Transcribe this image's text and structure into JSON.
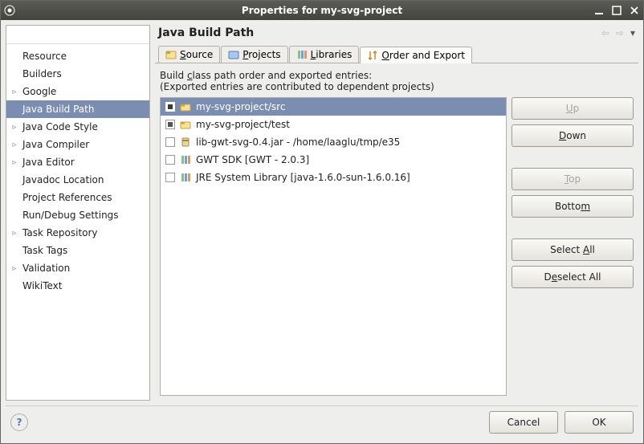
{
  "window": {
    "title": "Properties for my-svg-project"
  },
  "nav": {
    "search_value": "",
    "items": [
      {
        "label": "Resource",
        "expandable": false
      },
      {
        "label": "Builders",
        "expandable": false
      },
      {
        "label": "Google",
        "expandable": true
      },
      {
        "label": "Java Build Path",
        "expandable": false,
        "selected": true
      },
      {
        "label": "Java Code Style",
        "expandable": true
      },
      {
        "label": "Java Compiler",
        "expandable": true
      },
      {
        "label": "Java Editor",
        "expandable": true
      },
      {
        "label": "Javadoc Location",
        "expandable": false
      },
      {
        "label": "Project References",
        "expandable": false
      },
      {
        "label": "Run/Debug Settings",
        "expandable": false
      },
      {
        "label": "Task Repository",
        "expandable": true
      },
      {
        "label": "Task Tags",
        "expandable": false
      },
      {
        "label": "Validation",
        "expandable": true
      },
      {
        "label": "WikiText",
        "expandable": false
      }
    ]
  },
  "main": {
    "heading": "Java Build Path",
    "tabs": [
      {
        "label": "Source",
        "underline_index": 0,
        "icon": "source"
      },
      {
        "label": "Projects",
        "underline_index": 0,
        "icon": "projects"
      },
      {
        "label": "Libraries",
        "underline_index": 0,
        "icon": "libraries"
      },
      {
        "label": "Order and Export",
        "underline_index": 0,
        "icon": "order",
        "active": true
      }
    ],
    "description_prefix": "Build ",
    "description_underline": "c",
    "description_suffix": "lass path order and exported entries:",
    "description_sub": "(Exported entries are contributed to dependent projects)",
    "entries": [
      {
        "label": "my-svg-project/src",
        "checked": true,
        "selected": true,
        "icon": "package"
      },
      {
        "label": "my-svg-project/test",
        "checked": true,
        "selected": false,
        "icon": "package"
      },
      {
        "label": "lib-gwt-svg-0.4.jar - /home/laaglu/tmp/e35",
        "checked": false,
        "selected": false,
        "icon": "jar"
      },
      {
        "label": "GWT SDK [GWT - 2.0.3]",
        "checked": false,
        "selected": false,
        "icon": "library"
      },
      {
        "label": "JRE System Library [java-1.6.0-sun-1.6.0.16]",
        "checked": false,
        "selected": false,
        "icon": "library"
      }
    ],
    "buttons": {
      "up": "Up",
      "up_u": "U",
      "down": "own",
      "down_u": "D",
      "top": "op",
      "top_u": "T",
      "bottom": "Botto",
      "bottom_u": "m",
      "select_all_pre": "Select ",
      "select_all_u": "A",
      "select_all_post": "ll",
      "deselect_all_pre": "D",
      "deselect_all_u": "e",
      "deselect_all_post": "select All"
    }
  },
  "footer": {
    "cancel": "Cancel",
    "ok": "OK"
  }
}
